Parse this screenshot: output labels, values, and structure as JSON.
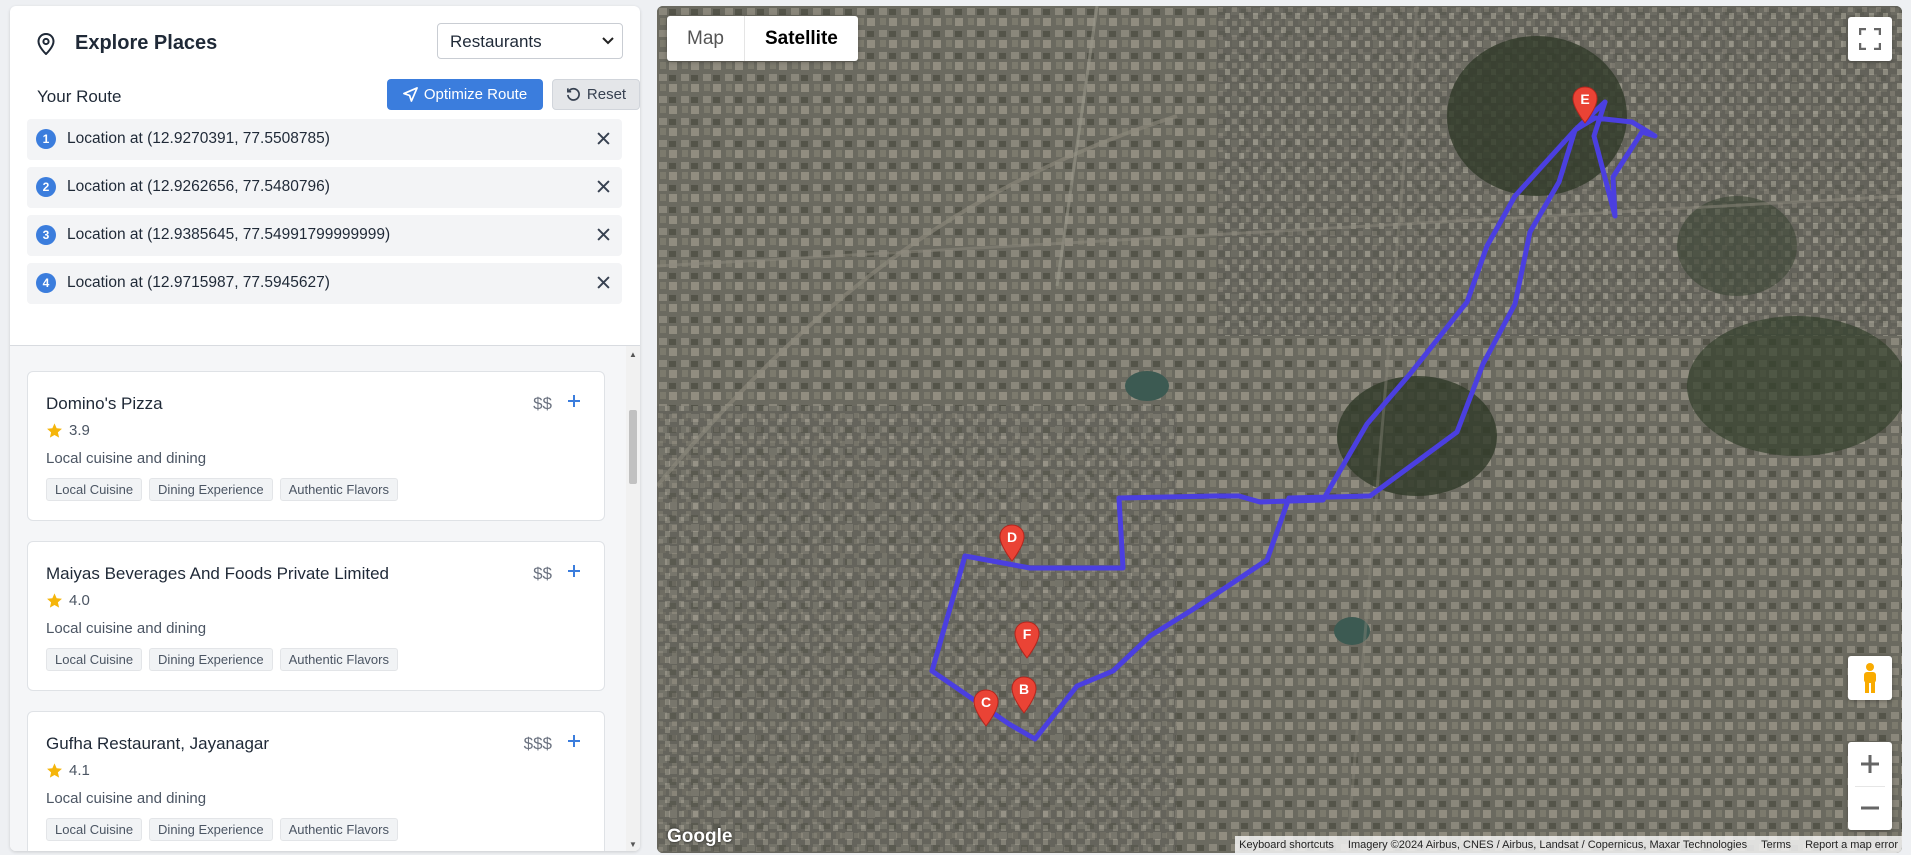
{
  "sidebar": {
    "title": "Explore Places",
    "category_select": "Restaurants",
    "route_title": "Your Route",
    "optimize_label": "Optimize Route",
    "reset_label": "Reset",
    "stops": [
      {
        "num": "1",
        "label": "Location at (12.9270391, 77.5508785)"
      },
      {
        "num": "2",
        "label": "Location at (12.9262656, 77.5480796)"
      },
      {
        "num": "3",
        "label": "Location at (12.9385645, 77.54991799999999)"
      },
      {
        "num": "4",
        "label": "Location at (12.9715987, 77.5945627)"
      }
    ],
    "places": [
      {
        "name": "Domino's Pizza",
        "price": "$$",
        "rating": "3.9",
        "desc": "Local cuisine and dining",
        "tags": [
          "Local Cuisine",
          "Dining Experience",
          "Authentic Flavors"
        ]
      },
      {
        "name": "Maiyas Beverages And Foods Private Limited",
        "price": "$$",
        "rating": "4.0",
        "desc": "Local cuisine and dining",
        "tags": [
          "Local Cuisine",
          "Dining Experience",
          "Authentic Flavors"
        ]
      },
      {
        "name": "Gufha Restaurant, Jayanagar",
        "price": "$$$",
        "rating": "4.1",
        "desc": "Local cuisine and dining",
        "tags": [
          "Local Cuisine",
          "Dining Experience",
          "Authentic Flavors"
        ]
      }
    ]
  },
  "map": {
    "type_map": "Map",
    "type_satellite": "Satellite",
    "markers": [
      "B",
      "C",
      "D",
      "E",
      "F"
    ],
    "logo": "Google",
    "attr_shortcuts": "Keyboard shortcuts",
    "attr_imagery": "Imagery ©2024 Airbus, CNES / Airbus, Landsat / Copernicus, Maxar Technologies",
    "attr_terms": "Terms",
    "attr_report": "Report a map error"
  },
  "colors": {
    "accent": "#3b7ddd",
    "route": "#4b3fe0",
    "marker": "#ea4335",
    "star": "#f5b50a"
  }
}
